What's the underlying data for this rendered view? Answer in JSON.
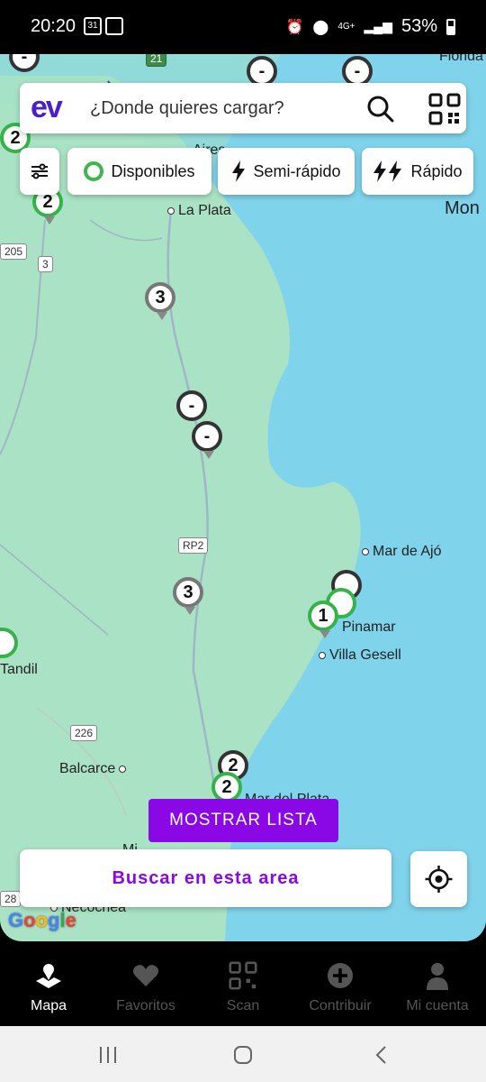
{
  "status_bar": {
    "time": "20:20",
    "calendar_day": "31",
    "network": "4G+",
    "battery": "53%"
  },
  "search": {
    "logo": "ev",
    "placeholder": "¿Donde quieres cargar?"
  },
  "filters": {
    "availability": "Disponibles",
    "semi_fast": "Semi-rápido",
    "fast": "Rápido"
  },
  "places": {
    "florida": "Florida",
    "la_plata": "La Plata",
    "mon": "Mon",
    "mar_de_ajo": "Mar de Ajó",
    "pinamar": "Pinamar",
    "villa_gesell": "Villa Gesell",
    "tandil": "Tandil",
    "balcarce": "Balcarce",
    "mar_del_plata": "Mar del Plata",
    "necochea": "Necochea",
    "aires": "Aires",
    "mi": "Mi"
  },
  "roads": {
    "r21": "21",
    "r205": "205",
    "r3": "3",
    "rp2": "RP2",
    "r226": "226",
    "r28": "28"
  },
  "markers": {
    "m1": "-",
    "m2": "-",
    "m3": "-",
    "m4": "2",
    "m5": "2",
    "m6": "3",
    "m7": "-",
    "m8": "-",
    "m9": "3",
    "m10": "1",
    "m11": "2",
    "m12": "2"
  },
  "actions": {
    "show_list": "MOSTRAR LISTA",
    "search_area": "Buscar en esta area"
  },
  "attribution": "Google",
  "nav": {
    "map": "Mapa",
    "favorites": "Favoritos",
    "scan": "Scan",
    "contribute": "Contribuir",
    "account": "Mi cuenta"
  },
  "colors": {
    "accent": "#8a07e6",
    "brand": "#4b20c9",
    "available": "#36b24a",
    "land": "#a9e2c4",
    "water": "#7fd3ea"
  }
}
